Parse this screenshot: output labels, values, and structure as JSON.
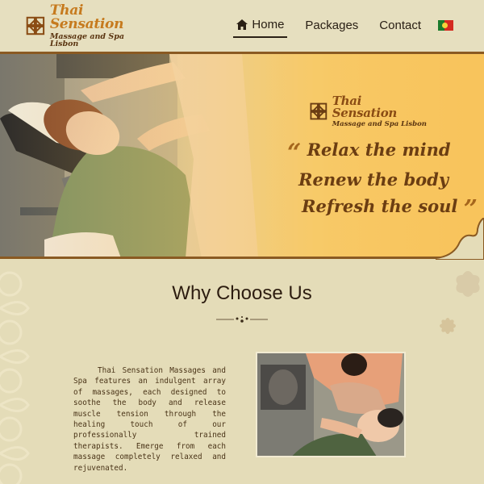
{
  "header": {
    "logo_title": "Thai Sensation",
    "logo_subtitle": "Massage and Spa Lisbon",
    "nav": {
      "home": "Home",
      "packages": "Packages",
      "contact": "Contact"
    },
    "language_icon": "portugal-flag-icon"
  },
  "hero": {
    "logo_title": "Thai Sensation",
    "logo_subtitle": "Massage and Spa Lisbon",
    "open_quote": "“",
    "close_quote": "”",
    "tagline": [
      "Relax the mind",
      "Renew the body",
      "Refresh the soul"
    ]
  },
  "why": {
    "title": "Why Choose Us",
    "body": "Thai Sensation Massages and Spa features an indulgent array of massages, each designed to soothe the body and release muscle tension through the healing touch of our professionally trained therapists. Emerge from each massage completely relaxed and rejuvenated."
  },
  "colors": {
    "background": "#e4dcb8",
    "brand_orange": "#c67a1e",
    "brand_brown": "#6b3d12",
    "hero_gold": "#f8c45c"
  }
}
